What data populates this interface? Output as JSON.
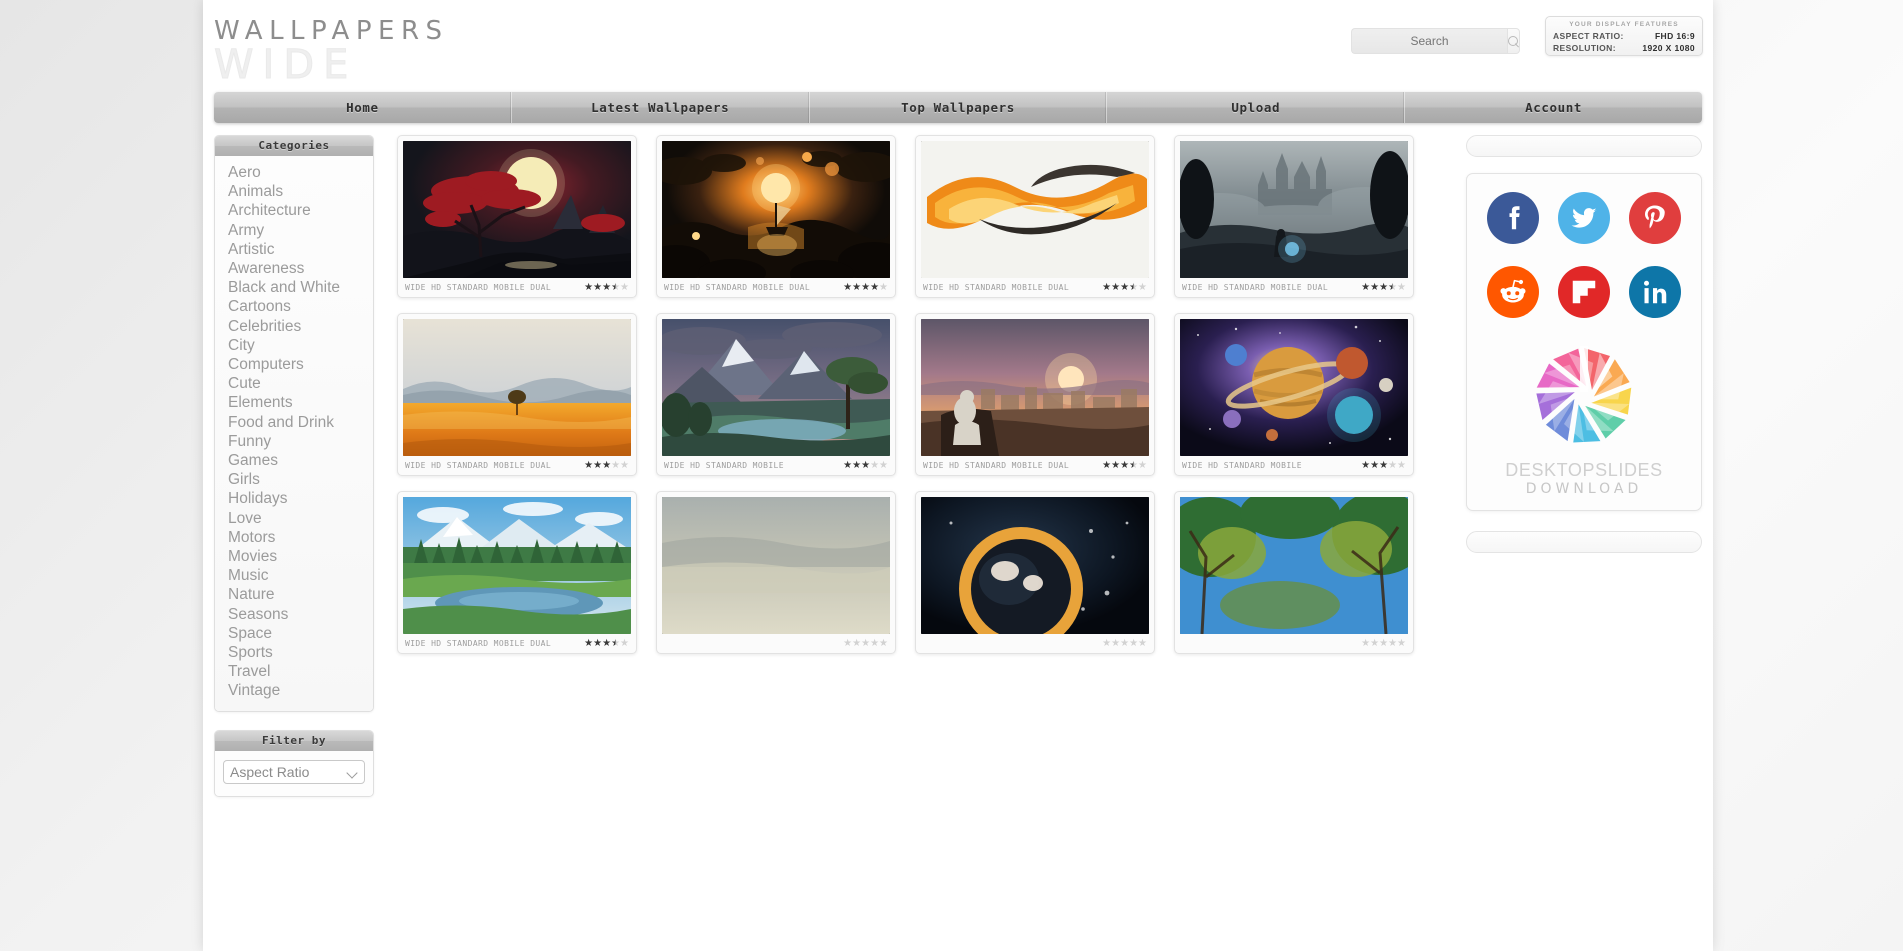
{
  "site": {
    "logo_top": "WALLPAPERS",
    "logo_bottom": "WIDE"
  },
  "search": {
    "value": "",
    "placeholder": "Search",
    "icon": "search-icon"
  },
  "display_features": {
    "title": "YOUR DISPLAY FEATURES",
    "aspect_label": "ASPECT RATIO:",
    "aspect_value": "FHD 16:9",
    "resolution_label": "RESOLUTION:",
    "resolution_value": "1920 X 1080"
  },
  "nav": {
    "items": [
      {
        "label": "Home"
      },
      {
        "label": "Latest Wallpapers"
      },
      {
        "label": "Top Wallpapers"
      },
      {
        "label": "Upload"
      },
      {
        "label": "Account"
      }
    ]
  },
  "sidebar": {
    "categories_title": "Categories",
    "categories": [
      {
        "label": "Aero"
      },
      {
        "label": "Animals"
      },
      {
        "label": "Architecture"
      },
      {
        "label": "Army"
      },
      {
        "label": "Artistic"
      },
      {
        "label": "Awareness"
      },
      {
        "label": "Black and White"
      },
      {
        "label": "Cartoons"
      },
      {
        "label": "Celebrities"
      },
      {
        "label": "City"
      },
      {
        "label": "Computers"
      },
      {
        "label": "Cute"
      },
      {
        "label": "Elements"
      },
      {
        "label": "Food and Drink"
      },
      {
        "label": "Funny"
      },
      {
        "label": "Games"
      },
      {
        "label": "Girls"
      },
      {
        "label": "Holidays"
      },
      {
        "label": "Love"
      },
      {
        "label": "Motors"
      },
      {
        "label": "Movies"
      },
      {
        "label": "Music"
      },
      {
        "label": "Nature"
      },
      {
        "label": "Seasons"
      },
      {
        "label": "Space"
      },
      {
        "label": "Sports"
      },
      {
        "label": "Travel"
      },
      {
        "label": "Vintage"
      }
    ],
    "filter_title": "Filter by",
    "filter_selected": "Aspect Ratio",
    "filter_options": [
      "Aspect Ratio"
    ]
  },
  "gallery": {
    "items": [
      {
        "tags": "WIDE HD STANDARD MOBILE DUAL",
        "rating": 3.5,
        "alt": "red-maple-tree-moon-wallpaper"
      },
      {
        "tags": "WIDE HD STANDARD MOBILE DUAL",
        "rating": 4,
        "alt": "sailing-ship-sunset-wallpaper"
      },
      {
        "tags": "WIDE HD STANDARD MOBILE DUAL",
        "rating": 3.5,
        "alt": "abstract-orange-smoke-wallpaper"
      },
      {
        "tags": "WIDE HD STANDARD MOBILE DUAL",
        "rating": 3.5,
        "alt": "castle-in-mist-wizard-wallpaper"
      },
      {
        "tags": "WIDE HD STANDARD MOBILE DUAL",
        "rating": 3,
        "alt": "lone-tree-golden-field-wallpaper"
      },
      {
        "tags": "WIDE HD STANDARD MOBILE",
        "rating": 3,
        "alt": "mountain-lake-tree-wallpaper"
      },
      {
        "tags": "WIDE HD STANDARD MOBILE DUAL",
        "rating": 3.5,
        "alt": "desert-city-sunrise-wallpaper"
      },
      {
        "tags": "WIDE HD STANDARD MOBILE",
        "rating": 3,
        "alt": "planets-space-wallpaper"
      },
      {
        "tags": "WIDE HD STANDARD MOBILE DUAL",
        "rating": 3.5,
        "alt": "green-forest-lake-wallpaper"
      },
      {
        "tags": "",
        "rating": 0,
        "alt": "foggy-landscape-wallpaper"
      },
      {
        "tags": "",
        "rating": 0,
        "alt": "astronaut-helmet-wallpaper"
      },
      {
        "tags": "",
        "rating": 0,
        "alt": "autumn-trees-blue-sky-wallpaper"
      }
    ]
  },
  "rail": {
    "social": [
      {
        "name": "facebook",
        "label": "Facebook",
        "color": "#3b5998"
      },
      {
        "name": "twitter",
        "label": "Twitter",
        "color": "#4fb3e8"
      },
      {
        "name": "pinterest",
        "label": "Pinterest",
        "color": "#e03e3e"
      },
      {
        "name": "reddit",
        "label": "Reddit",
        "color": "#ff5700"
      },
      {
        "name": "flipboard",
        "label": "Flipboard",
        "color": "#e12828"
      },
      {
        "name": "linkedin",
        "label": "LinkedIn",
        "color": "#0e76a8"
      }
    ],
    "promo_title": "DESKTOPSLIDES",
    "promo_subtitle": "DOWNLOAD"
  }
}
